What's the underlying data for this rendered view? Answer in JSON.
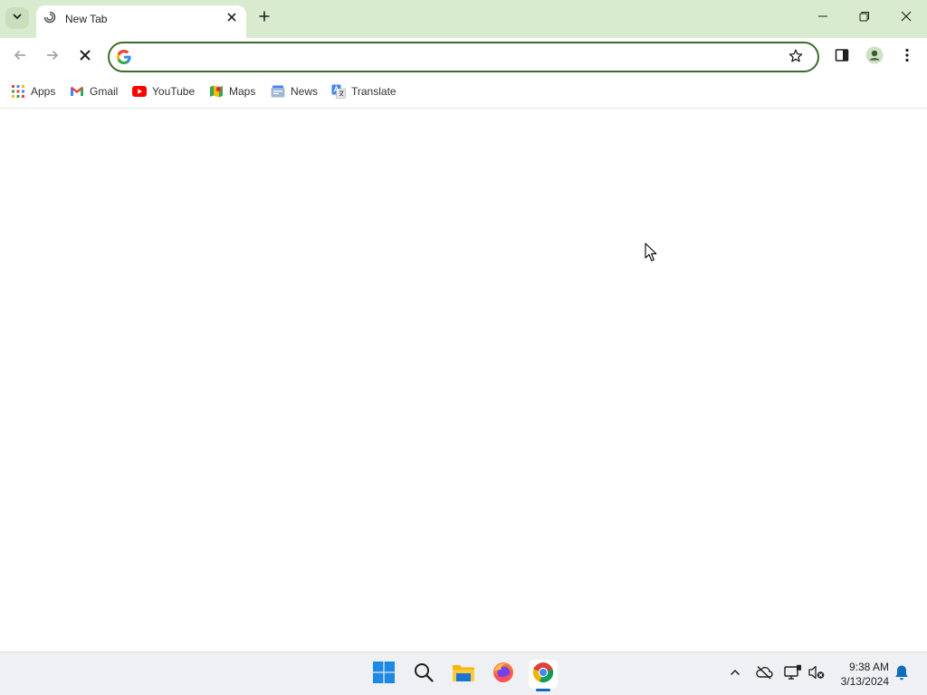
{
  "browser": {
    "tab_title": "New Tab",
    "omnibox_value": "",
    "icons": {
      "tab_search": "chevron-down-icon",
      "favicon": "loading-icon",
      "close_tab": "close-icon",
      "new_tab": "plus-icon",
      "minimize": "minimize-icon",
      "restore": "restore-icon",
      "close_window": "close-icon",
      "back": "back-arrow-icon",
      "forward": "forward-arrow-icon",
      "stop": "stop-icon",
      "google": "google-icon",
      "bookmark_star": "star-icon",
      "side_panel": "side-panel-icon",
      "profile": "profile-icon",
      "menu": "kebab-menu-icon"
    },
    "colors": {
      "frame": "#d9ebcf",
      "omnibox_border": "#3d6a2c",
      "accent": "#0f6cbd"
    }
  },
  "bookmarks": [
    {
      "label": "Apps",
      "icon": "apps-grid-icon"
    },
    {
      "label": "Gmail",
      "icon": "gmail-icon"
    },
    {
      "label": "YouTube",
      "icon": "youtube-icon"
    },
    {
      "label": "Maps",
      "icon": "maps-icon"
    },
    {
      "label": "News",
      "icon": "news-icon"
    },
    {
      "label": "Translate",
      "icon": "translate-icon"
    }
  ],
  "taskbar": {
    "apps": [
      "windows-start-icon",
      "search-icon",
      "file-explorer-icon",
      "firefox-icon",
      "chrome-icon"
    ],
    "tray": [
      "chevron-up-icon",
      "onedrive-offline-icon",
      "network-icon",
      "volume-muted-icon",
      "notification-bell-icon"
    ],
    "time": "9:38 AM",
    "date": "3/13/2024"
  }
}
